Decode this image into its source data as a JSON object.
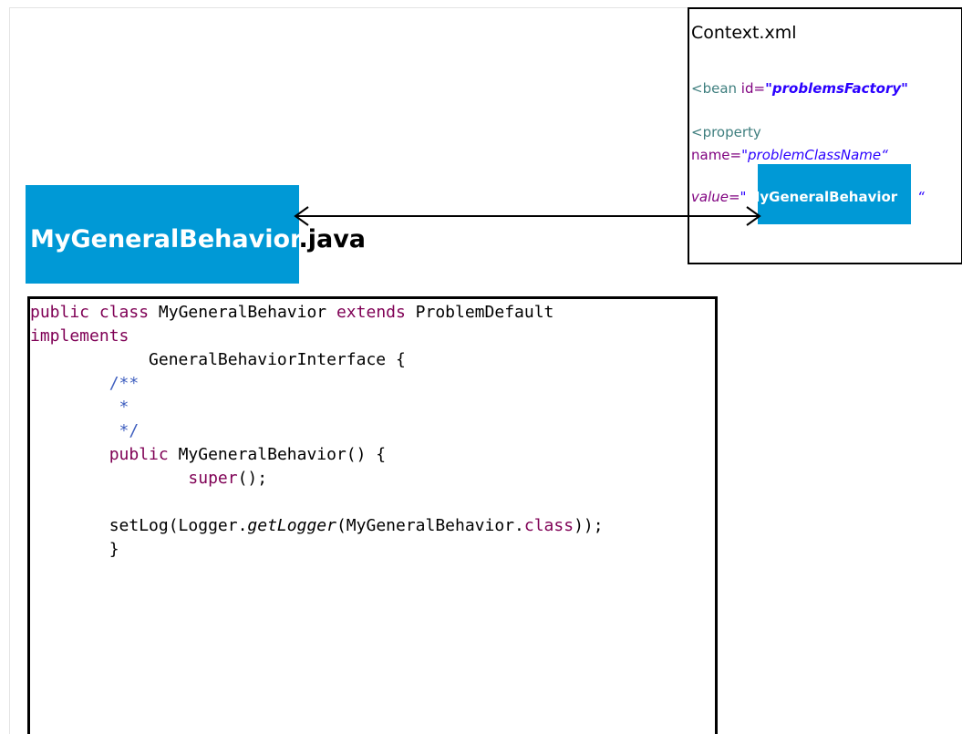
{
  "xml_box": {
    "title": "Context.xml",
    "bean_open": "<bean ",
    "bean_attr": "id=",
    "bean_value": "\"problemsFactory\"",
    "property_open": "<property",
    "property_attr": "name=",
    "property_value": "\"problemClassName“",
    "value_attr": "value=",
    "value_quote_open": "\"",
    "value_highlight": "MyGeneralBehavior",
    "value_quote_close": "“"
  },
  "java_title": {
    "class_name": "MyGeneralBehavior",
    "extension": ".java"
  },
  "code": {
    "line1_kw1": "public",
    "line1_kw2": "class",
    "line1_name": " MyGeneralBehavior ",
    "line1_kw3": "extends",
    "line1_super": " ProblemDefault",
    "line2_kw": "implements",
    "line3": "            GeneralBehaviorInterface {",
    "line4": "/**",
    "line5": " *",
    "line6": " */",
    "line7_kw": "public",
    "line7_rest": " MyGeneralBehavior() {",
    "line8_kw": "super",
    "line8_rest": "();",
    "line10_a": "setLog(Logger.",
    "line10_b": "getLogger",
    "line10_c": "(MyGeneralBehavior.",
    "line10_kw": "class",
    "line10_d": "));",
    "line11": "}"
  },
  "colors": {
    "highlight_blue": "#0099d6",
    "keyword": "#7f0055",
    "comment": "#3f5fbf",
    "xml_tag": "#3f7f7f",
    "xml_attr": "#7f007f",
    "xml_string": "#2a00ff"
  }
}
